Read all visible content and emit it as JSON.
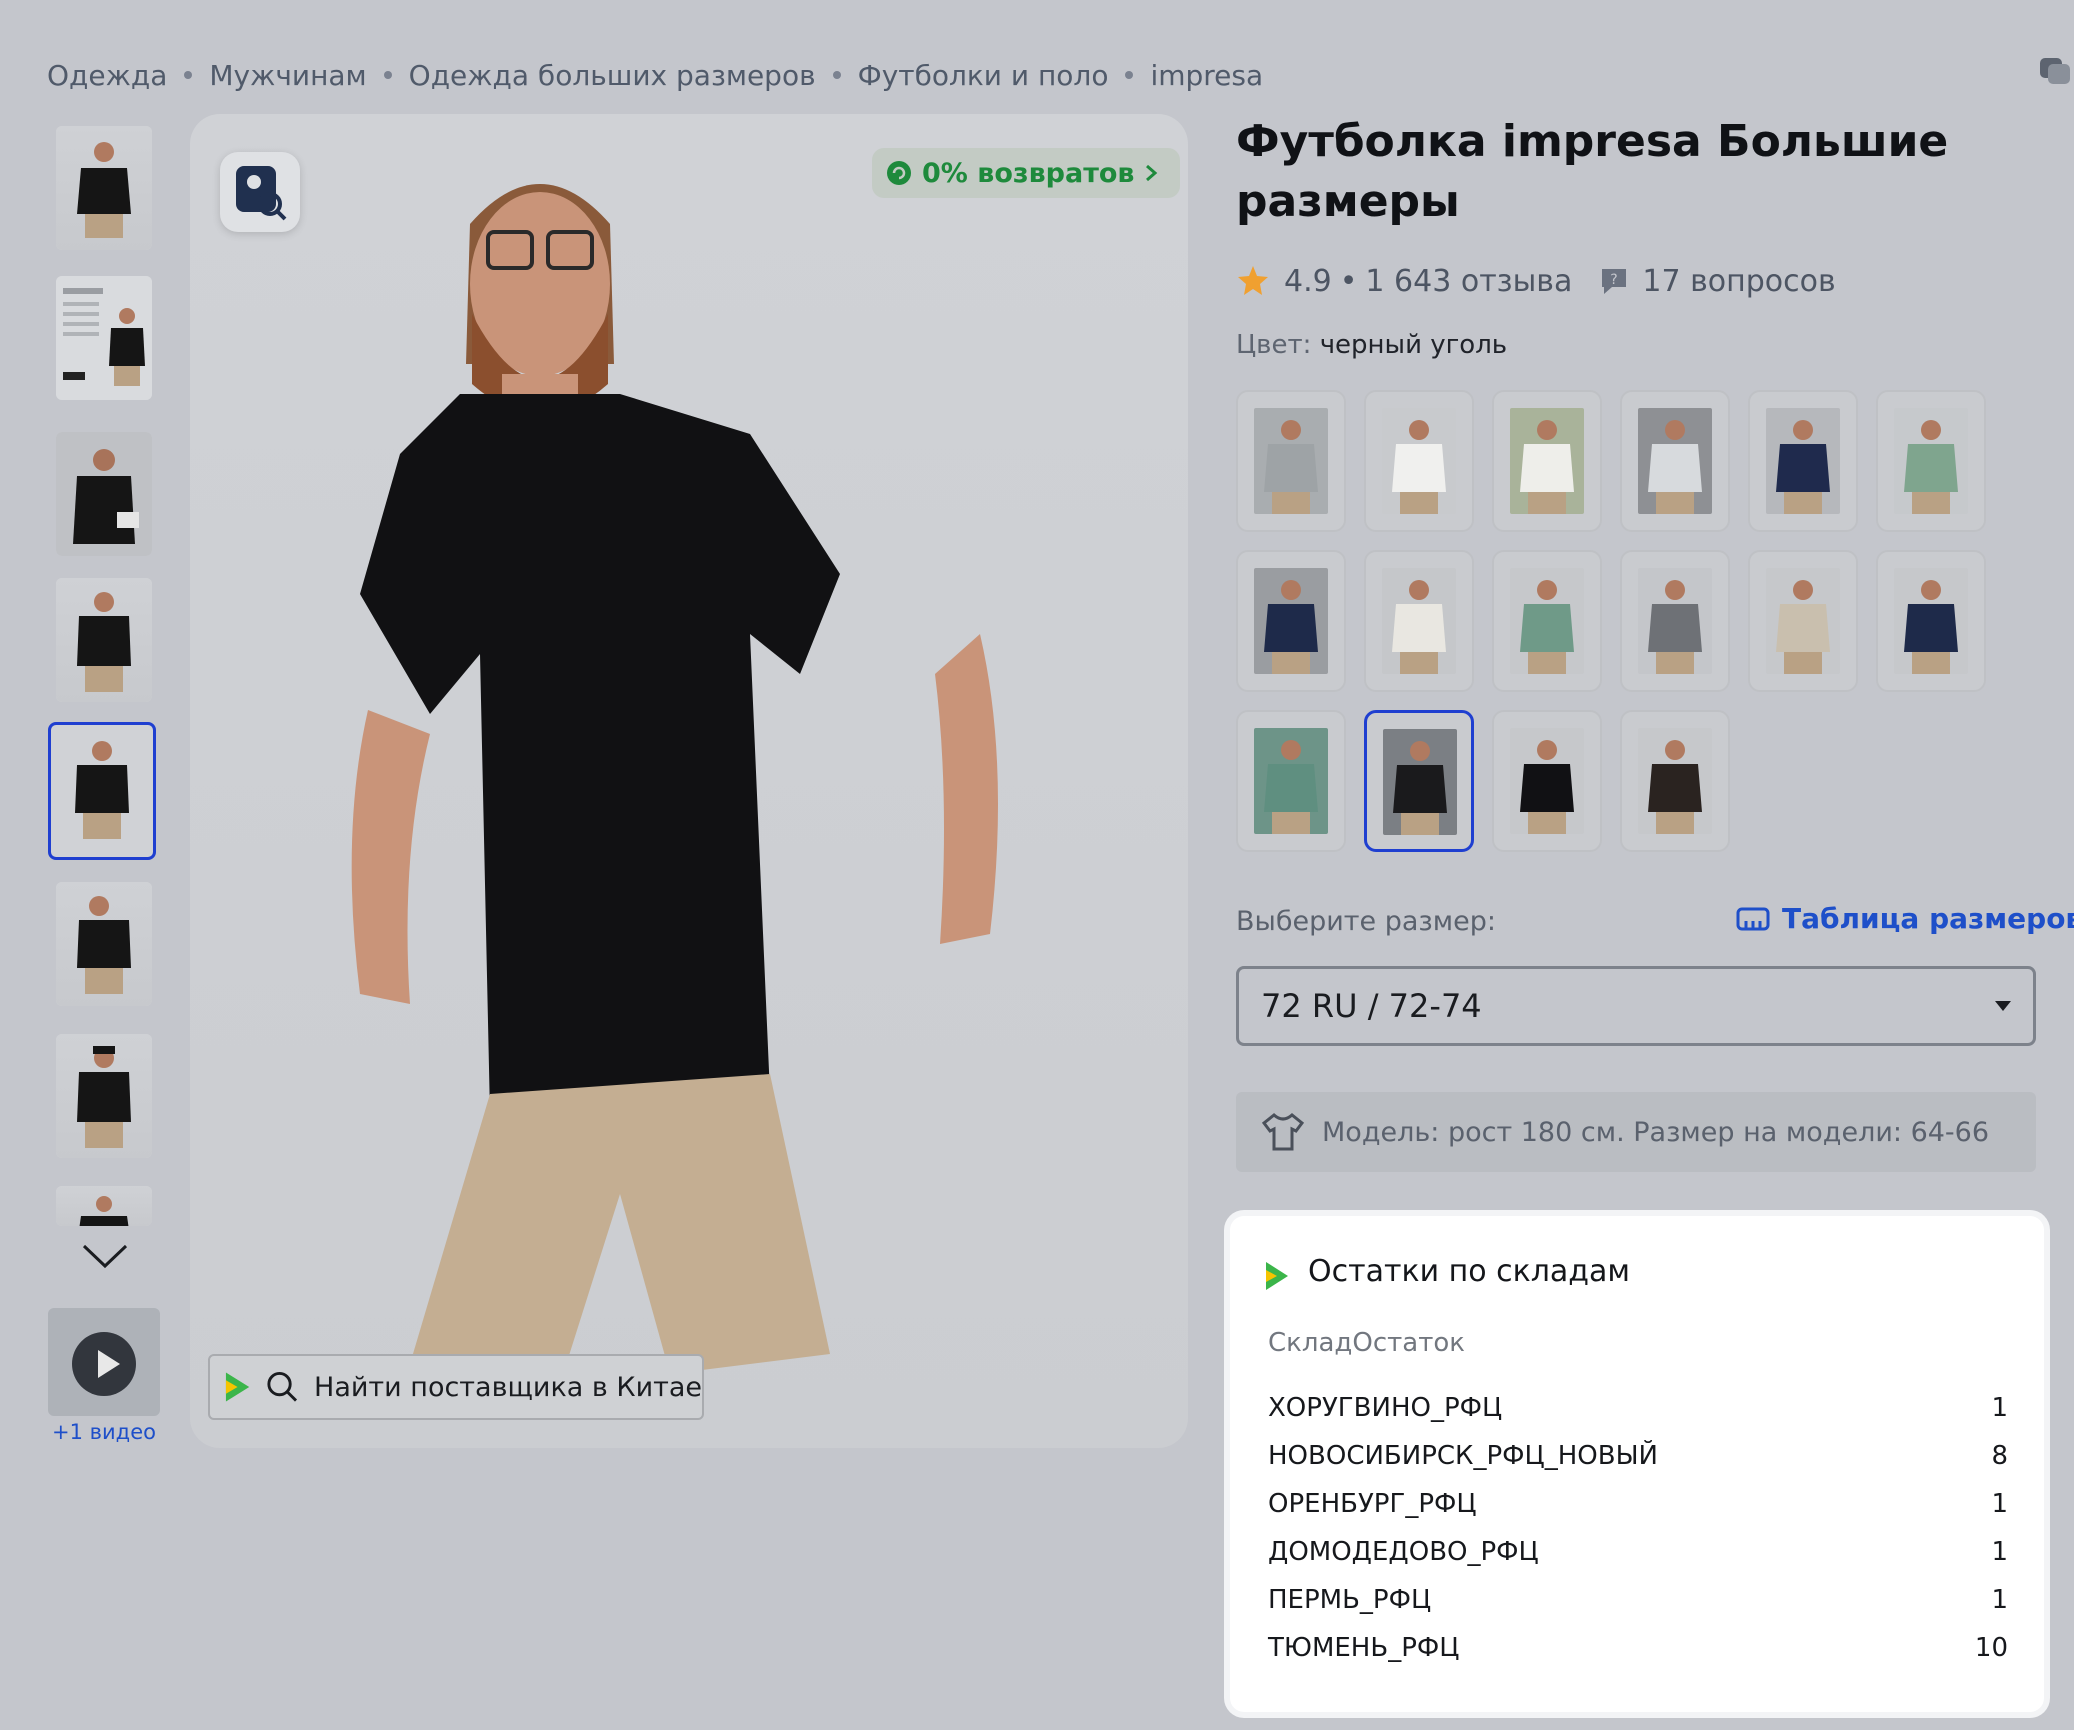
{
  "breadcrumb": [
    "Одежда",
    "Мужчинам",
    "Одежда больших размеров",
    "Футболки и поло",
    "impresa"
  ],
  "gallery": {
    "video_label": "+1 видео",
    "returns_badge": "0% возвратов",
    "find_supplier": "Найти поставщика в Китае"
  },
  "product": {
    "title": "Футболка impresa Большие размеры",
    "rating": "4.9",
    "reviews": "1 643 отзыва",
    "questions": "17 вопросов",
    "color_label": "Цвет:",
    "color_value": "черный уголь"
  },
  "swatches": [
    {
      "shirt": "#9ea3a6",
      "bg": "#a9adb0"
    },
    {
      "shirt": "#f0f0ee",
      "bg": "#c8cacd"
    },
    {
      "shirt": "#eeeeea",
      "bg": "#a9b39a"
    },
    {
      "shirt": "#d7dadd",
      "bg": "#8e9094"
    },
    {
      "shirt": "#1f2a4d",
      "bg": "#b6b8bc"
    },
    {
      "shirt": "#7fa58e",
      "bg": "#c6c9cc"
    },
    {
      "shirt": "#1e2a4a",
      "bg": "#9a9da1"
    },
    {
      "shirt": "#e9e7e1",
      "bg": "#c5c7ca"
    },
    {
      "shirt": "#6f9a88",
      "bg": "#c6c8cb"
    },
    {
      "shirt": "#6e7176",
      "bg": "#c4c6ca"
    },
    {
      "shirt": "#c9bfae",
      "bg": "#c6c8cb"
    },
    {
      "shirt": "#1e2a4a",
      "bg": "#c6c8cb"
    },
    {
      "shirt": "#5f8f80",
      "bg": "#6d9488"
    },
    {
      "shirt": "#1a1a1c",
      "bg": "#7b7f84"
    },
    {
      "shirt": "#111114",
      "bg": "#c6c8cb"
    },
    {
      "shirt": "#2a2320",
      "bg": "#c6c8cb"
    }
  ],
  "size": {
    "label": "Выберите размер:",
    "table_link": "Таблица размеров",
    "selected": "72 RU / 72-74"
  },
  "model_info": "Модель: рост 180 см. Размер на модели: 64-66",
  "stock": {
    "title": "Остатки по складам",
    "header": "СкладОстаток",
    "rows": [
      {
        "warehouse": "ХОРУГВИНО_РФЦ",
        "qty": "1"
      },
      {
        "warehouse": "НОВОСИБИРСК_РФЦ_НОВЫЙ",
        "qty": "8"
      },
      {
        "warehouse": "ОРЕНБУРГ_РФЦ",
        "qty": "1"
      },
      {
        "warehouse": "ДОМОДЕДОВО_РФЦ",
        "qty": "1"
      },
      {
        "warehouse": "ПЕРМЬ_РФЦ",
        "qty": "1"
      },
      {
        "warehouse": "ТЮМЕНЬ_РФЦ",
        "qty": "10"
      }
    ]
  },
  "colors": {
    "accent_blue": "#1f3fd0",
    "link_blue": "#1e4fc9",
    "returns_green": "#1e8a3c",
    "star": "#f0a030",
    "brand_green": "#3bb54a"
  }
}
